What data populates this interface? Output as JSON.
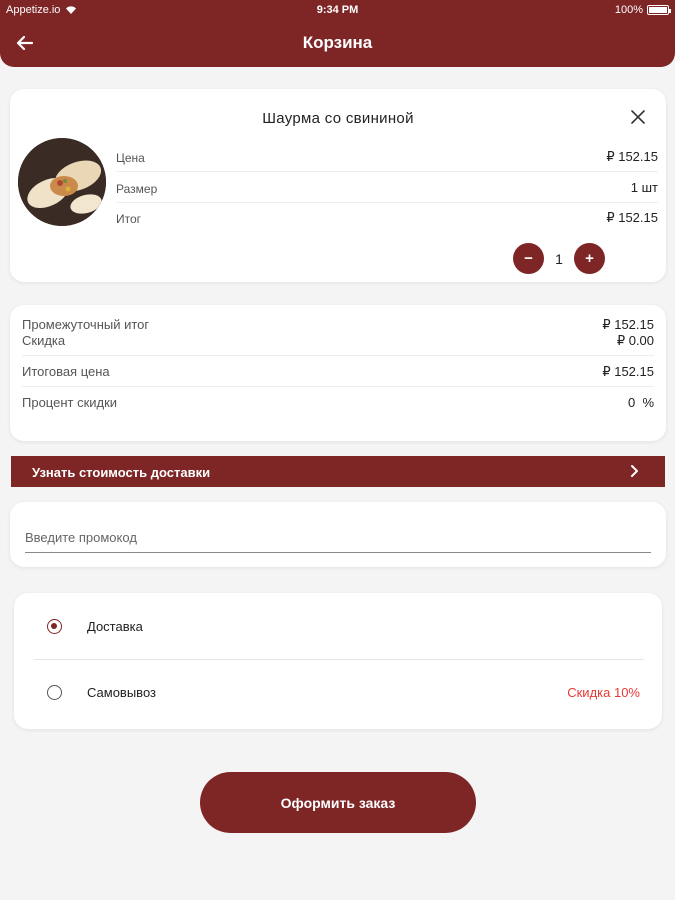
{
  "status_bar": {
    "carrier": "Appetize.io",
    "time": "9:34 PM",
    "battery": "100%"
  },
  "header": {
    "title": "Корзина"
  },
  "cart_item": {
    "name": "Шаурма со свининой",
    "rows": [
      {
        "label": "Цена",
        "value": "₽ 152.15"
      },
      {
        "label": "Размер",
        "value": "1 шт"
      },
      {
        "label": "Итог",
        "value": "₽ 152.15"
      }
    ],
    "quantity": "1",
    "minus": "−",
    "plus": "+"
  },
  "summary": {
    "subtotal_label": "Промежуточный итог",
    "subtotal_value": "₽ 152.15",
    "discount_label": "Скидка",
    "discount_value": "₽ 0.00",
    "total_label": "Итоговая цена",
    "total_value": "₽ 152.15",
    "percent_label": "Процент скидки",
    "percent_value": "0  %"
  },
  "delivery_cost": {
    "label": "Узнать стоимость доставки"
  },
  "promo": {
    "placeholder": "Введите промокод"
  },
  "methods": [
    {
      "label": "Доставка",
      "selected": true
    },
    {
      "label": "Самовывоз",
      "selected": false,
      "note": "Скидка 10%"
    }
  ],
  "checkout": {
    "label": "Оформить заказ"
  },
  "colors": {
    "primary": "#7e2526",
    "discount": "#e53935",
    "background": "#f4f4f4"
  }
}
